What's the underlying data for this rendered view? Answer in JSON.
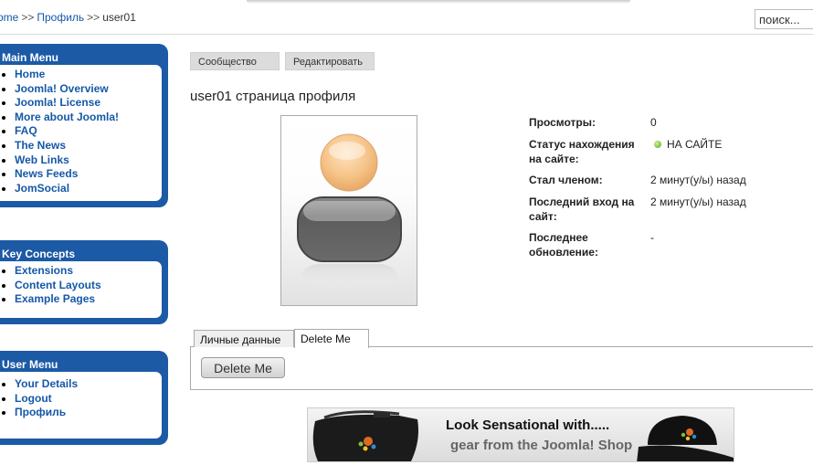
{
  "breadcrumb": {
    "home": "ome",
    "sep1": ">>",
    "profile": "Профиль",
    "sep2": ">>",
    "current": "user01"
  },
  "search": {
    "value": "поиск..."
  },
  "menus": {
    "main": {
      "title": "Main Menu",
      "items": [
        "Home",
        "Joomla! Overview",
        "Joomla! License",
        "More about Joomla!",
        "FAQ",
        "The News",
        "Web Links",
        "News Feeds",
        "JomSocial"
      ]
    },
    "key": {
      "title": "Key Concepts",
      "items": [
        "Extensions",
        "Content Layouts",
        "Example Pages"
      ]
    },
    "user": {
      "title": "User Menu",
      "items": [
        "Your Details",
        "Logout",
        "Профиль"
      ]
    }
  },
  "profile": {
    "buttons": {
      "community": "Сообщество",
      "edit": "Редактировать"
    },
    "title": "user01 страница профиля",
    "info": {
      "views_label": "Просмотры:",
      "views_value": "0",
      "status_label": "Статус нахождения на сайте:",
      "status_value": "НА САЙТЕ",
      "member_label": "Стал членом:",
      "member_value": "2 минут(у/ы) назад",
      "lastvisit_label": "Последний вход на сайт:",
      "lastvisit_value": "2 минут(у/ы) назад",
      "updated_label": "Последнее обновление:",
      "updated_value": "-"
    },
    "tabs": {
      "personal": "Личные данные",
      "delete": "Delete Me"
    },
    "delete_button": "Delete Me"
  },
  "banner": {
    "line1": "Look Sensational with.....",
    "line2": "gear from the Joomla! Shop"
  },
  "colors": {
    "menu_blue": "#1c5aa6",
    "link_blue": "#1558a8",
    "online_green": "#59a31a"
  }
}
